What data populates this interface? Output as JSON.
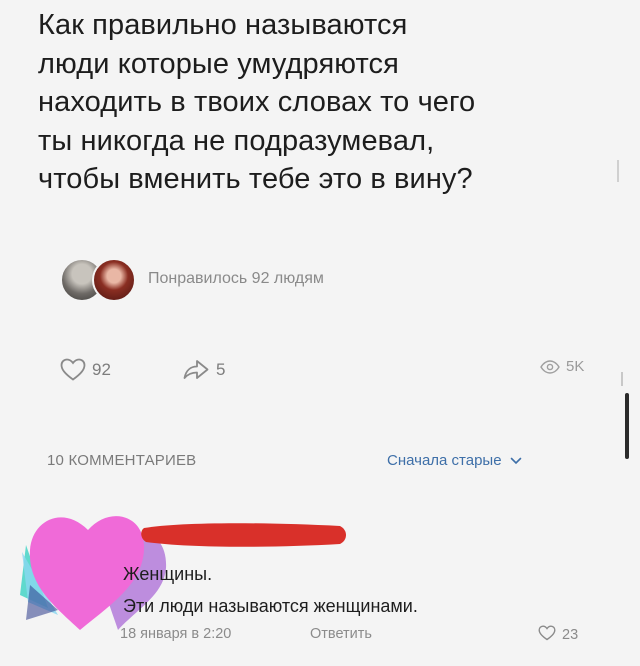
{
  "post": {
    "lines": [
      "Как правильно называются",
      "люди которые умудряются",
      "находить в твоих словах то чего",
      "ты никогда не подразумевал,",
      "чтобы вменить тебе это в вину?"
    ],
    "liked_by_text": "Понравилось 92 людям"
  },
  "actions": {
    "likes": "92",
    "shares": "5",
    "views": "5K"
  },
  "comments": {
    "count_label": "10 КОММЕНТАРИЕВ",
    "sort_label": "Сначала старые",
    "first": {
      "line1": "Женщины.",
      "line2": "Эти люди называются женщинами.",
      "date": "18 января в 2:20",
      "reply_label": "Ответить",
      "likes": "23"
    }
  },
  "colors": {
    "background": "#f4f4f4",
    "link": "#3e6fa8",
    "muted": "#8b8b8b",
    "redaction": "#d9302a",
    "heart_pink": "#f06ad8",
    "heart_purple": "#b37ad9"
  },
  "icons": {
    "like": "heart-outline-icon",
    "share": "share-arrow-icon",
    "views": "eye-icon",
    "sort": "chevron-down-icon"
  }
}
